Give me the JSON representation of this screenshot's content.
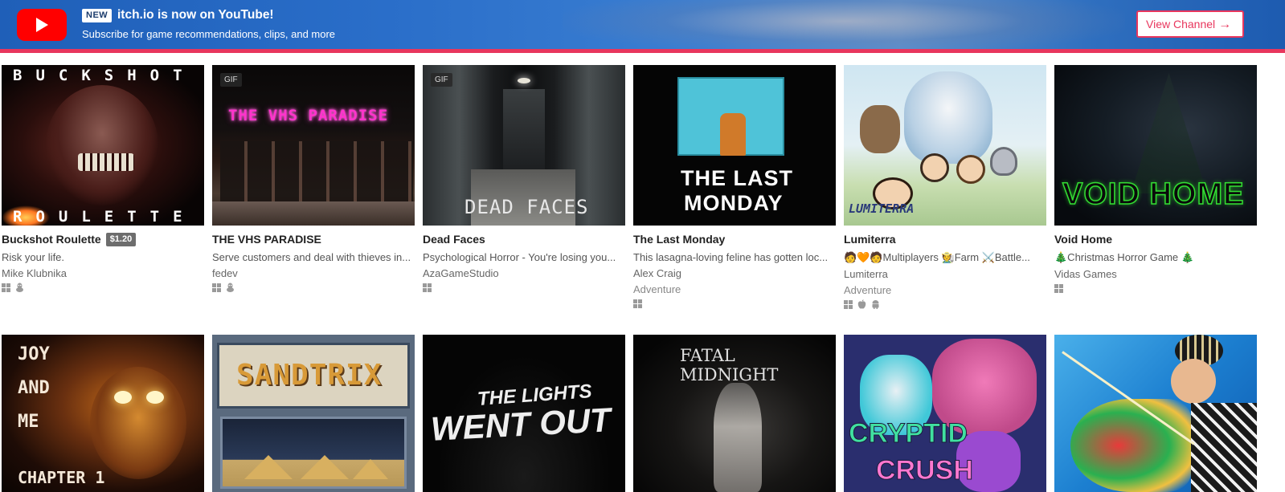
{
  "banner": {
    "new_label": "NEW",
    "title": "itch.io is now on YouTube!",
    "subtitle": "Subscribe for game recommendations, clips, and more",
    "button_label": "View Channel",
    "button_arrow": "→",
    "accent_color": "#e8365d",
    "youtube_color": "#ff0000"
  },
  "games_row1": [
    {
      "title": "Buckshot Roulette",
      "price": "$1.20",
      "description": "Risk your life.",
      "author": "Mike Klubnika",
      "genre": "",
      "platforms": [
        "windows-icon",
        "linux-icon"
      ],
      "thumb_text_top": "BUCKSHOT",
      "thumb_text_bottom": "ROULETTE"
    },
    {
      "title": "THE VHS PARADISE",
      "badge": "GIF",
      "description": "Serve customers and deal with thieves in...",
      "author": "fedev",
      "genre": "",
      "platforms": [
        "windows-icon",
        "linux-icon"
      ],
      "thumb_text": "THE VHS PARADISE"
    },
    {
      "title": "Dead Faces",
      "badge": "GIF",
      "description": "Psychological Horror - You're losing you...",
      "author": "AzaGameStudio",
      "genre": "",
      "platforms": [
        "windows-icon"
      ],
      "thumb_text": "DEAD FACES"
    },
    {
      "title": "The Last Monday",
      "description": "This lasagna-loving feline has gotten loc...",
      "author": "Alex Craig",
      "genre": "Adventure",
      "platforms": [
        "windows-icon"
      ],
      "thumb_text_1": "THE LAST",
      "thumb_text_2": "MONDAY"
    },
    {
      "title": "Lumiterra",
      "description": "🧑🧡🧑Multiplayers 🧑‍🌾Farm ⚔️Battle...",
      "author": "Lumiterra",
      "genre": "Adventure",
      "platforms": [
        "windows-icon",
        "apple-icon",
        "android-icon"
      ],
      "thumb_text": "LUMITERRA"
    },
    {
      "title": "Void Home",
      "description": "🎄Christmas Horror Game 🎄",
      "author": "Vidas Games",
      "genre": "",
      "platforms": [
        "windows-icon"
      ],
      "thumb_text": "VOID HOME"
    }
  ],
  "games_row2": [
    {
      "thumb_text_1": "JOY",
      "thumb_text_2": "AND",
      "thumb_text_3": "ME",
      "thumb_text_4": "CHAPTER 1"
    },
    {
      "thumb_text": "SANDTRIX"
    },
    {
      "thumb_text_1": "THE LIGHTS",
      "thumb_text_2": "WENT OUT"
    },
    {
      "thumb_text": "FATAL MIDNIGHT"
    },
    {
      "thumb_text_1": "CRYPTID",
      "thumb_text_2": "CRUSH"
    },
    {
      "thumb_text": ""
    }
  ]
}
